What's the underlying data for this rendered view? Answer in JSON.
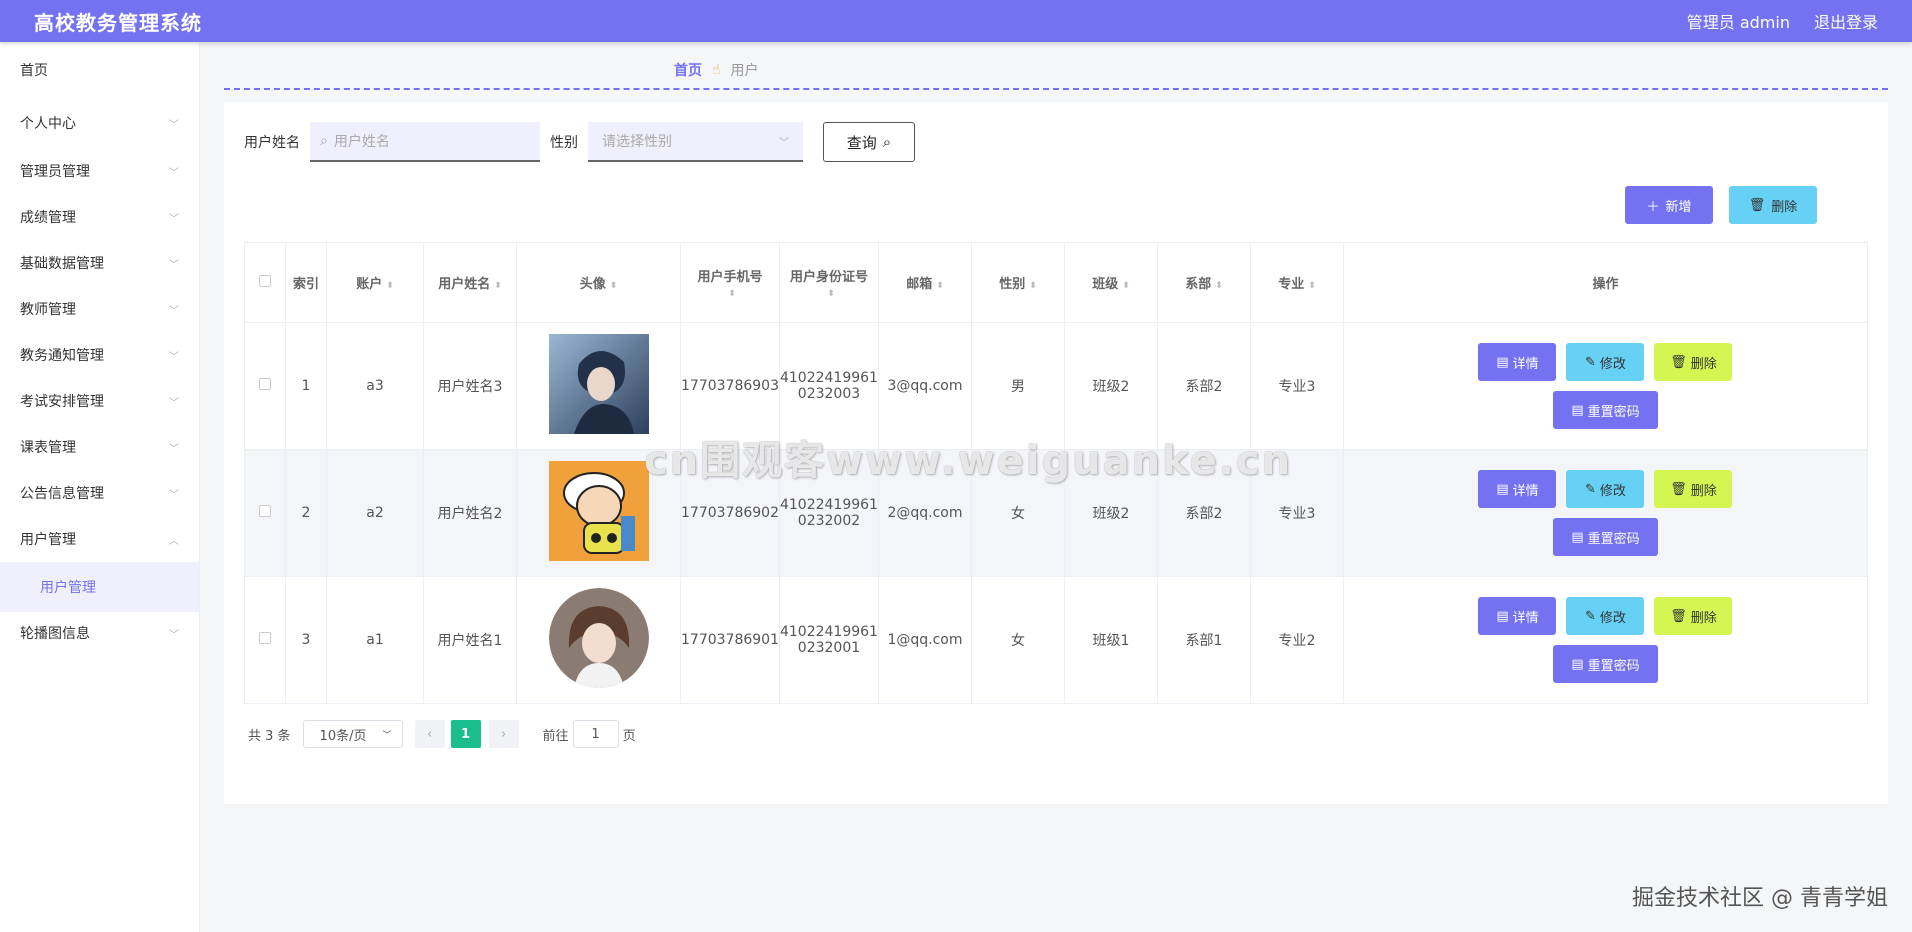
{
  "header": {
    "title": "高校教务管理系统",
    "user": "管理员 admin",
    "logout": "退出登录"
  },
  "sidebar": {
    "items": [
      {
        "label": "首页"
      },
      {
        "label": "个人中心"
      },
      {
        "label": "管理员管理"
      },
      {
        "label": "成绩管理"
      },
      {
        "label": "基础数据管理"
      },
      {
        "label": "教师管理"
      },
      {
        "label": "教务通知管理"
      },
      {
        "label": "考试安排管理"
      },
      {
        "label": "课表管理"
      },
      {
        "label": "公告信息管理"
      },
      {
        "label": "用户管理"
      },
      {
        "label": "轮播图信息"
      }
    ],
    "sub_active": "用户管理"
  },
  "breadcrumb": {
    "home": "首页",
    "current": "用户"
  },
  "search": {
    "name_label": "用户姓名",
    "name_placeholder": "用户姓名",
    "gender_label": "性别",
    "gender_placeholder": "请选择性别",
    "query_label": "查询"
  },
  "toolbar": {
    "add_label": "新增",
    "delete_label": "删除"
  },
  "table": {
    "headers": [
      "索引",
      "账户",
      "用户姓名",
      "头像",
      "用户手机号",
      "用户身份证号",
      "邮箱",
      "性别",
      "班级",
      "系部",
      "专业",
      "操作"
    ],
    "rows": [
      {
        "index": "1",
        "account": "a3",
        "name": "用户姓名3",
        "phone": "17703786903",
        "id_a": "41022419961",
        "id_b": "0232003",
        "email": "3@qq.com",
        "gender": "男",
        "class": "班级2",
        "dept": "系部2",
        "major": "专业3"
      },
      {
        "index": "2",
        "account": "a2",
        "name": "用户姓名2",
        "phone": "17703786902",
        "id_a": "41022419961",
        "id_b": "0232002",
        "email": "2@qq.com",
        "gender": "女",
        "class": "班级2",
        "dept": "系部2",
        "major": "专业3"
      },
      {
        "index": "3",
        "account": "a1",
        "name": "用户姓名1",
        "phone": "17703786901",
        "id_a": "41022419961",
        "id_b": "0232001",
        "email": "1@qq.com",
        "gender": "女",
        "class": "班级1",
        "dept": "系部1",
        "major": "专业2"
      }
    ],
    "ops": {
      "detail": "详情",
      "edit": "修改",
      "remove": "删除",
      "reset": "重置密码"
    }
  },
  "pager": {
    "total": "共 3 条",
    "page_size": "10条/页",
    "current_page": "1",
    "goto_prefix": "前往",
    "goto_value": "1",
    "goto_suffix": "页"
  },
  "watermark": "cn围观客www.weiguanke.cn",
  "corner_mark": "掘金技术社区 @ 青青学姐",
  "colors": {
    "primary": "#7472f0",
    "info": "#67d0f5",
    "warning": "#d4f552",
    "pager_active": "#19be8c"
  }
}
